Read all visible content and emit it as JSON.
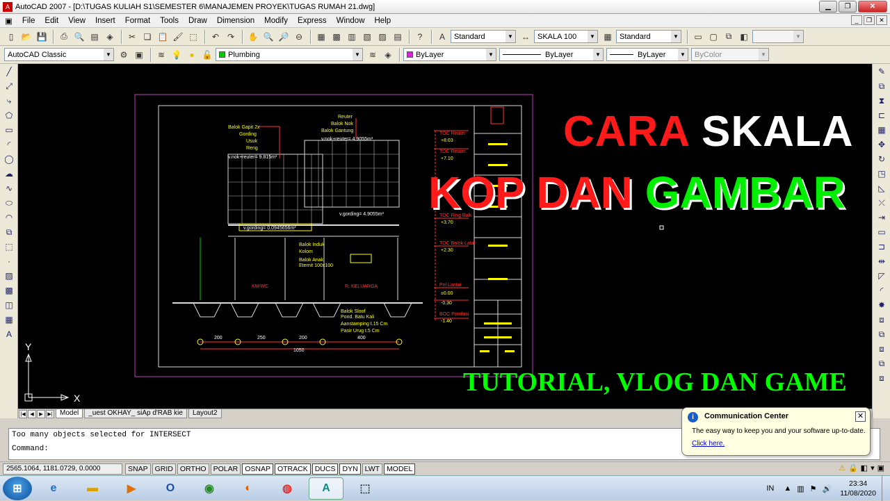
{
  "window": {
    "title": "AutoCAD 2007 - [D:\\TUGAS KULIAH S1\\SEMESTER 6\\MANAJEMEN PROYEK\\TUGAS RUMAH 21.dwg]"
  },
  "menu": [
    "File",
    "Edit",
    "View",
    "Insert",
    "Format",
    "Tools",
    "Draw",
    "Dimension",
    "Modify",
    "Express",
    "Window",
    "Help"
  ],
  "toolbar1": {
    "text_style": "Standard",
    "dim_style": "SKALA 100",
    "table_style": "Standard"
  },
  "toolbar2": {
    "workspace": "AutoCAD Classic",
    "layer": "Plumbing",
    "color": "ByLayer",
    "linetype": "ByLayer",
    "lineweight": "ByLayer",
    "plotstyle": "ByColor"
  },
  "drawing": {
    "labels_yellow": [
      "Balok Gapit 2x",
      "Gording",
      "Usuk",
      "Reng",
      "Reuter",
      "Balok Nok",
      "Balok Gantung",
      "Balok Induk",
      "Kolom",
      "Balok Anak",
      "Eternit 100x100",
      "Balok Sloof",
      "Pond. Batu Kali",
      "Aanstamping t.15 Cm",
      "Pasir Urug t.5 Cm"
    ],
    "labels_white": [
      "v.nok+reuter= 9.815m³",
      "v.nok+reuter= 4.9055m³",
      "v.gording= 0.0945656m³",
      "v.gording= 4.9055m³"
    ],
    "labels_red": [
      "TOC Reuter",
      "TOC Reuter",
      "TOC Ring Balk",
      "TOC Balok Latai",
      "Pnl Lantai",
      "BOC Pondasi",
      "KM/WC",
      "R. KELUARGA"
    ],
    "elevations": [
      "+8.03",
      "+7.10",
      "+3.70",
      "+2.30",
      "±0.00",
      "-0.30",
      "-1.40"
    ],
    "dims": [
      "200",
      "250",
      "200",
      "400",
      "1050"
    ],
    "axis_y": "Y",
    "axis_x": "X"
  },
  "overlay": {
    "line1_a": "CARA",
    "line1_b": "SKALA",
    "line2_a": "KOP",
    "line2_b": "DAN",
    "line2_c": "GAMBAR",
    "line3": "TUTORIAL, VLOG DAN GAME"
  },
  "tabs": [
    "Model",
    "_uest OKHAY_ siAp d'RAB kie",
    "Layout2"
  ],
  "command": {
    "history": "Too many objects selected for INTERSECT",
    "prompt": "Command:"
  },
  "status": {
    "coords": "2565.1064, 1181.0729, 0.0000",
    "buttons": [
      "SNAP",
      "GRID",
      "ORTHO",
      "POLAR",
      "OSNAP",
      "OTRACK",
      "DUCS",
      "DYN",
      "LWT",
      "MODEL"
    ]
  },
  "popup": {
    "title": "Communication Center",
    "message": "The easy way to keep you and your software up-to-date.",
    "link": "Click here."
  },
  "taskbar": {
    "lang": "IN",
    "time": "23:34",
    "date": "11/08/2020"
  },
  "colors": {
    "canvas": "#000000",
    "red_text": "#ff1a1a",
    "green_text": "#00ee00",
    "frame_magenta": "#c040c0"
  }
}
